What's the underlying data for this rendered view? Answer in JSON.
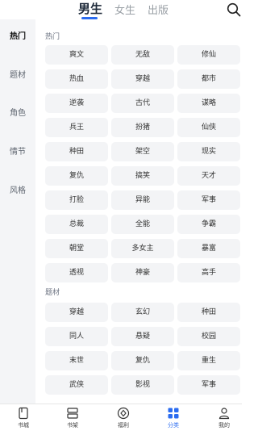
{
  "top_tabs": [
    {
      "label": "男生",
      "active": true
    },
    {
      "label": "女生",
      "active": false
    },
    {
      "label": "出版",
      "active": false
    }
  ],
  "accent": "#2b6cf0",
  "sidebar": {
    "items": [
      {
        "label": "热门",
        "active": true
      },
      {
        "label": "题材",
        "active": false
      },
      {
        "label": "角色",
        "active": false
      },
      {
        "label": "情节",
        "active": false
      },
      {
        "label": "风格",
        "active": false
      }
    ]
  },
  "sections": [
    {
      "title": "热门",
      "tags": [
        "爽文",
        "无敌",
        "修仙",
        "热血",
        "穿越",
        "都市",
        "逆袭",
        "古代",
        "谋略",
        "兵王",
        "扮猪",
        "仙侠",
        "种田",
        "架空",
        "现实",
        "复仇",
        "搞笑",
        "天才",
        "打脸",
        "异能",
        "军事",
        "总裁",
        "全能",
        "争霸",
        "朝堂",
        "多女主",
        "暴富",
        "透视",
        "神豪",
        "高手"
      ]
    },
    {
      "title": "题材",
      "tags": [
        "穿越",
        "玄幻",
        "种田",
        "同人",
        "悬疑",
        "校园",
        "末世",
        "复仇",
        "重生",
        "武侠",
        "影视",
        "军事"
      ]
    }
  ],
  "bottom_nav": [
    {
      "label": "书城",
      "icon": "book-icon",
      "active": false
    },
    {
      "label": "书架",
      "icon": "bookshelf-icon",
      "active": false
    },
    {
      "label": "福利",
      "icon": "gift-diamond-icon",
      "active": false
    },
    {
      "label": "分类",
      "icon": "category-grid-icon",
      "active": true
    },
    {
      "label": "我的",
      "icon": "profile-icon",
      "active": false
    }
  ]
}
